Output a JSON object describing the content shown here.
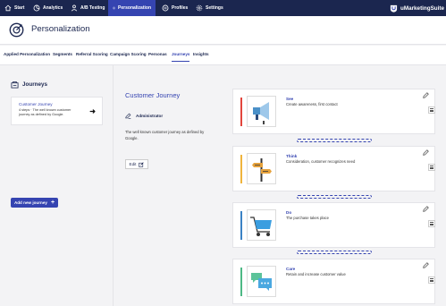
{
  "nav": {
    "items": [
      {
        "label": "Start",
        "icon": "home-icon"
      },
      {
        "label": "Analytics",
        "icon": "analytics-icon"
      },
      {
        "label": "A/B Testing",
        "icon": "ab-testing-icon"
      },
      {
        "label": "Personalization",
        "icon": "personalization-icon",
        "active": true
      },
      {
        "label": "Profiles",
        "icon": "profiles-icon"
      },
      {
        "label": "Settings",
        "icon": "settings-icon"
      }
    ],
    "brand": "uMarketingSuite"
  },
  "header": {
    "title": "Personalization",
    "icon": "personalization-logo-icon"
  },
  "tabs": [
    {
      "label": "Applied Personalization"
    },
    {
      "label": "Segments"
    },
    {
      "label": "Referral Scoring"
    },
    {
      "label": "Campaign Scoring"
    },
    {
      "label": "Personas"
    },
    {
      "label": "Journeys",
      "active": true
    },
    {
      "label": "Insights"
    }
  ],
  "sidebar": {
    "title": "Journeys",
    "icon": "journeys-icon",
    "journey": {
      "name": "Customer Journey",
      "description": "4 steps · The well known customer journey as defined by Google."
    },
    "add_button": "Add new journey"
  },
  "journey": {
    "title": "Customer Journey",
    "owner": "Administrator",
    "description": "The well known customer journey as defined by Google.",
    "edit_label": "Edit"
  },
  "stages": [
    {
      "name": "See",
      "description": "Create awareness, first contact",
      "color": "#e2453c",
      "icon": "megaphone-icon"
    },
    {
      "name": "Think",
      "description": "Consideration, customer recognizes need",
      "color": "#f0b43c",
      "icon": "signpost-icon"
    },
    {
      "name": "Do",
      "description": "The purchase takes place",
      "color": "#3b82c4",
      "icon": "shopping-cart-icon"
    },
    {
      "name": "Care",
      "description": "Retain and increase customer value",
      "color": "#4db885",
      "icon": "chat-bubbles-icon"
    }
  ],
  "colors": {
    "navy": "#1b264f",
    "accent": "#3544b1"
  }
}
